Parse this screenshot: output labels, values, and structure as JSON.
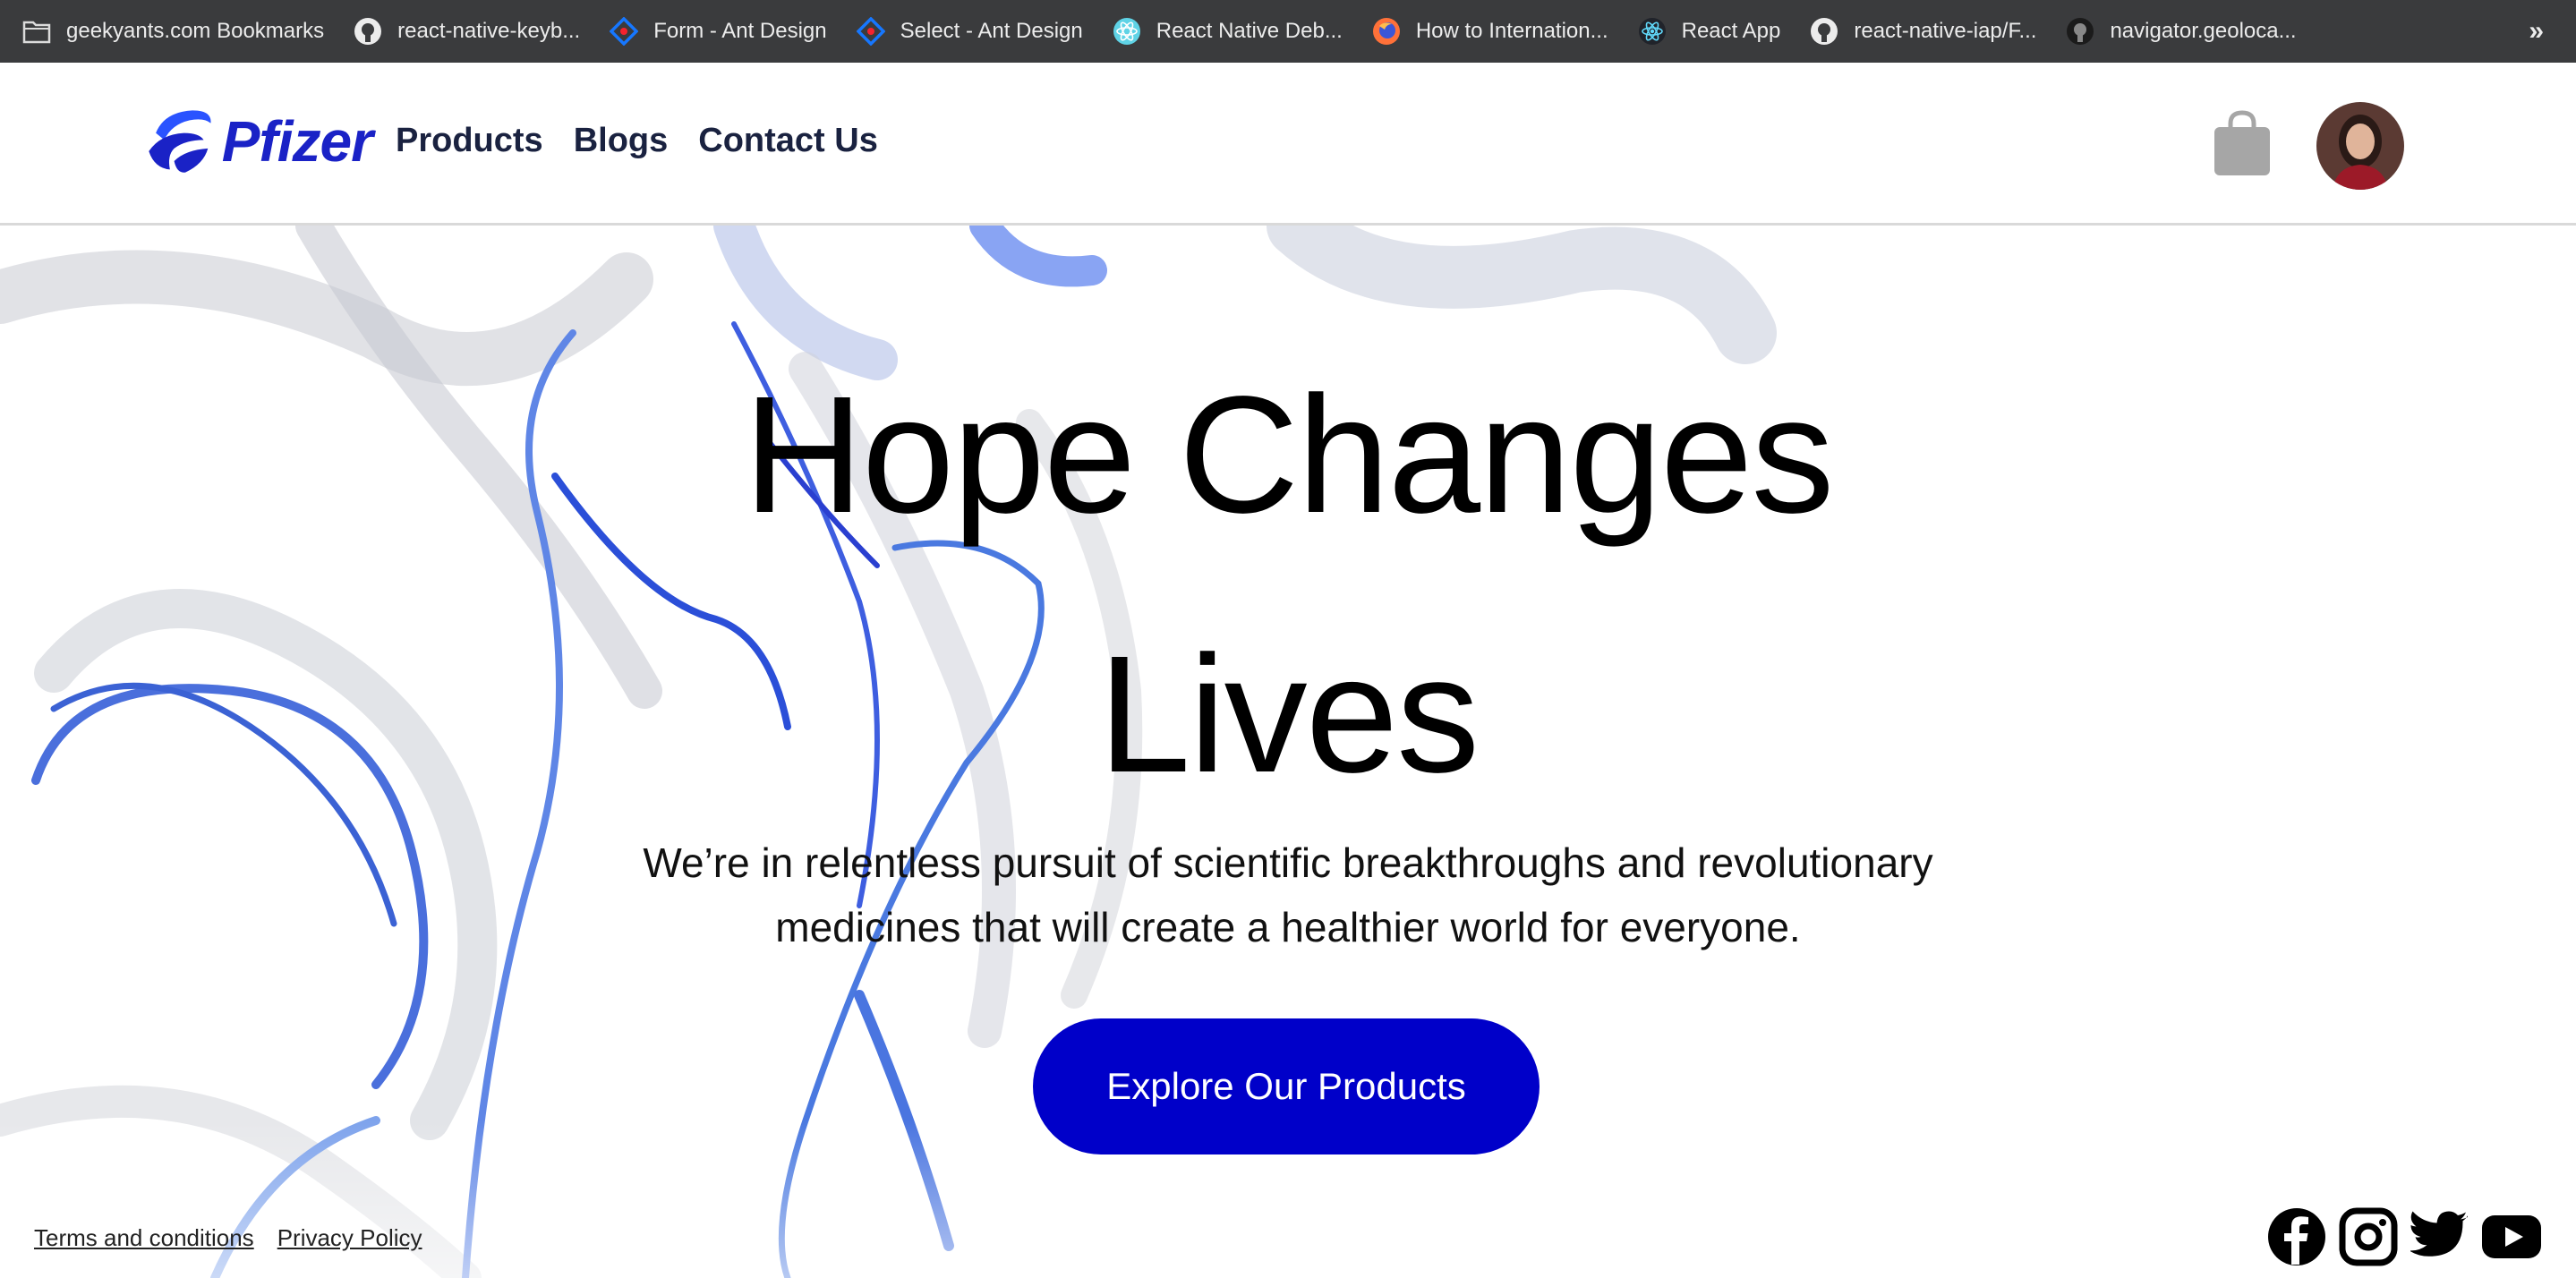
{
  "bookmarks": {
    "items": [
      {
        "label": "geekyants.com Bookmarks",
        "icon": "folder-icon"
      },
      {
        "label": "react-native-keyb...",
        "icon": "github-icon"
      },
      {
        "label": "Form - Ant Design",
        "icon": "ant-design-icon"
      },
      {
        "label": "Select - Ant Design",
        "icon": "ant-design-icon"
      },
      {
        "label": "React Native Deb...",
        "icon": "react-icon"
      },
      {
        "label": "How to Internation...",
        "icon": "firefox-icon"
      },
      {
        "label": "React App",
        "icon": "react-icon"
      },
      {
        "label": "react-native-iap/F...",
        "icon": "github-icon"
      },
      {
        "label": "navigator.geoloca...",
        "icon": "github-icon"
      }
    ],
    "more": "»"
  },
  "header": {
    "logo_text": "Pfizer",
    "nav": [
      "Products",
      "Blogs",
      "Contact Us"
    ]
  },
  "hero": {
    "headline_line1": "Hope Changes",
    "headline_line2": "Lives",
    "subtext_line1": "We’re in relentless pursuit of scientific breakthroughs and revolutionary",
    "subtext_line2": "medicines that will create a healthier world for everyone.",
    "cta": "Explore Our Products"
  },
  "footer": {
    "links": [
      "Terms and conditions",
      "Privacy Policy"
    ],
    "socials": [
      "facebook-icon",
      "instagram-icon",
      "twitter-icon",
      "youtube-icon"
    ]
  },
  "colors": {
    "bookmarks_bg": "#3a3b3d",
    "brand_blue": "#1a22c6",
    "cta_bg": "#0000c9",
    "nav_text": "#1a2240"
  }
}
